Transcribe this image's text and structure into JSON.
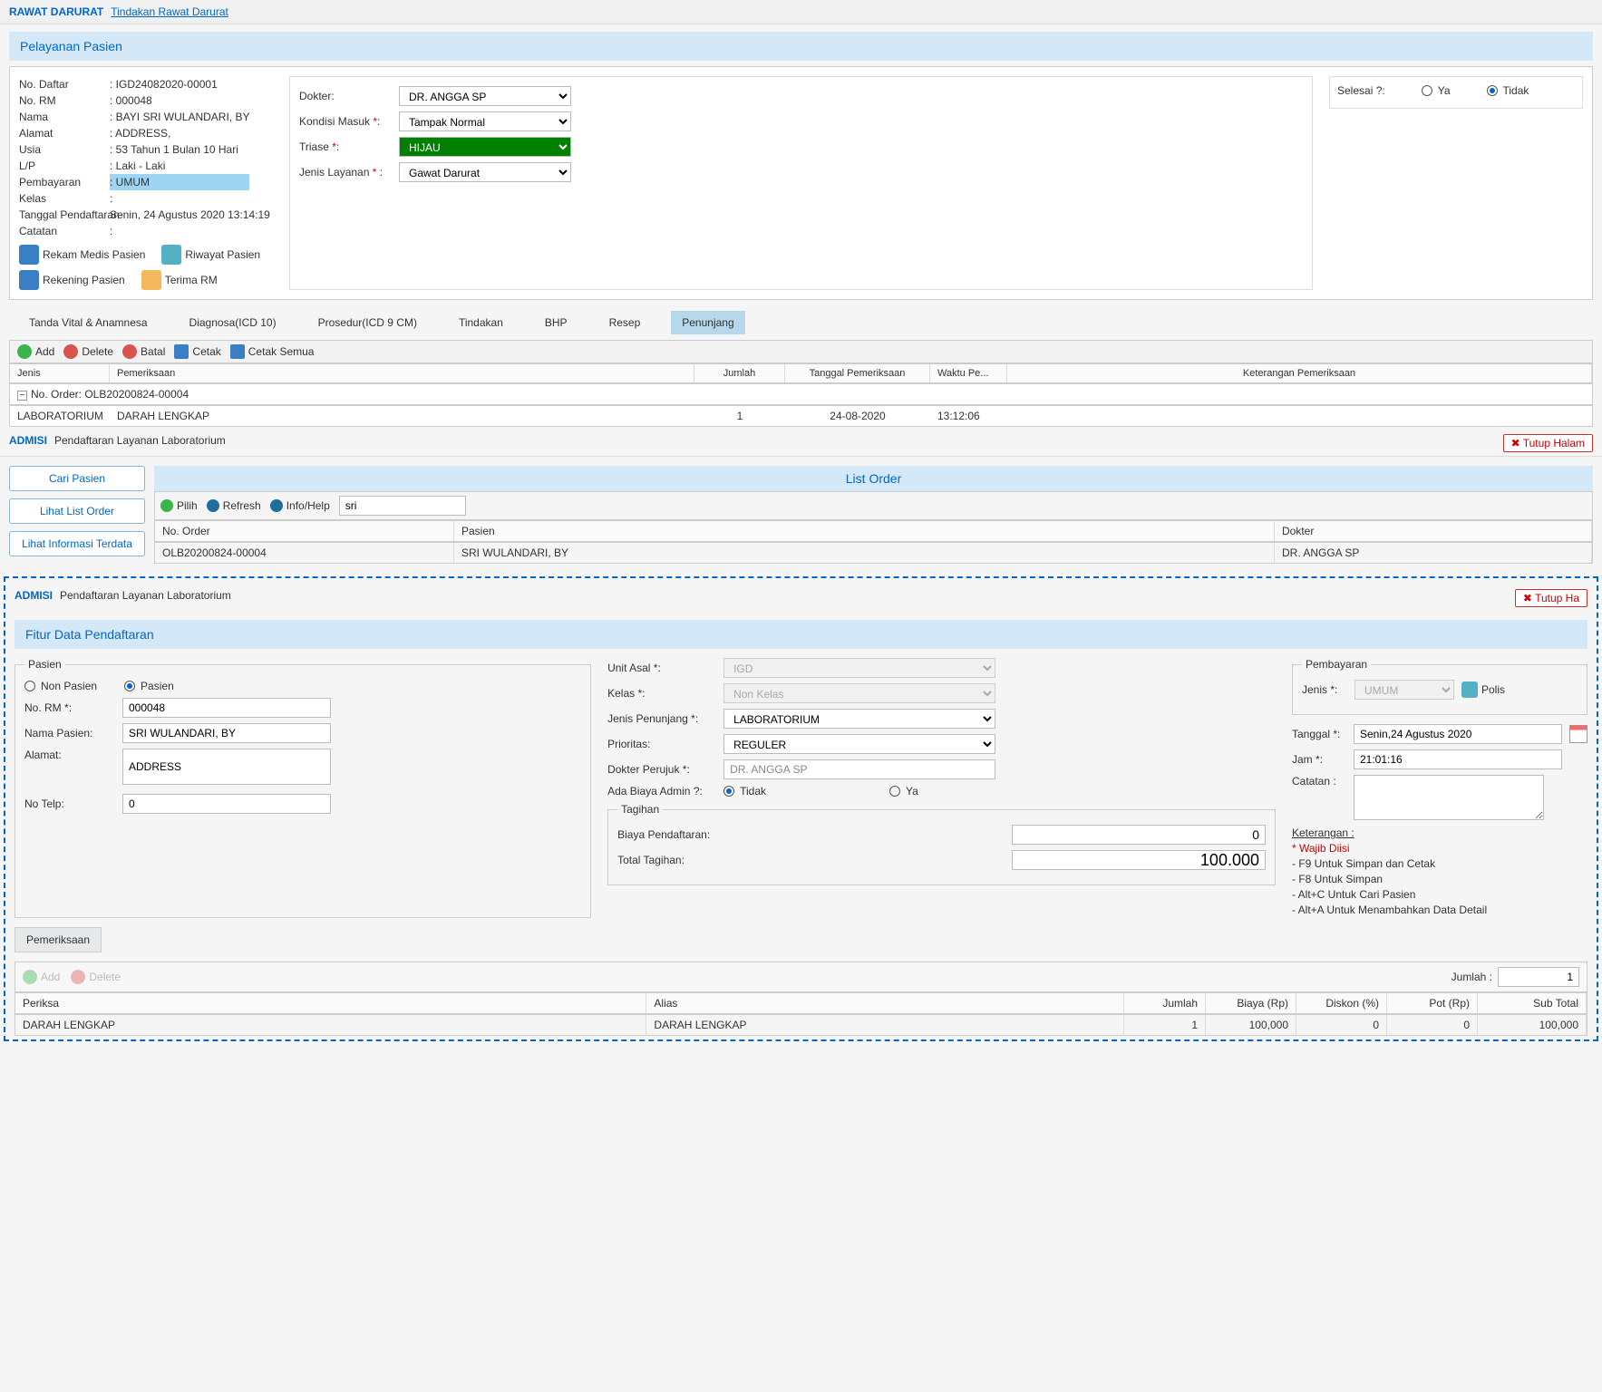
{
  "breadcrumb": {
    "section": "RAWAT DARURAT",
    "link": "Tindakan Rawat Darurat"
  },
  "pelayanan": {
    "title": "Pelayanan Pasien",
    "info": {
      "no_daftar_lbl": "No. Daftar",
      "no_daftar": "IGD24082020-00001",
      "no_rm_lbl": "No. RM",
      "no_rm": "000048",
      "nama_lbl": "Nama",
      "nama": "BAYI SRI WULANDARI, BY",
      "alamat_lbl": "Alamat",
      "alamat": "ADDRESS,",
      "usia_lbl": "Usia",
      "usia": "53 Tahun 1 Bulan 10 Hari",
      "lp_lbl": "L/P",
      "lp": "Laki - Laki",
      "pembayaran_lbl": "Pembayaran",
      "pembayaran": "UMUM",
      "kelas_lbl": "Kelas",
      "kelas": "",
      "tgl_lbl": "Tanggal Pendaftaran",
      "tgl": "Senin, 24 Agustus 2020 13:14:19",
      "catatan_lbl": "Catatan",
      "catatan": ""
    },
    "links": {
      "rekam_medis": "Rekam Medis Pasien",
      "riwayat": "Riwayat Pasien",
      "rekening": "Rekening Pasien",
      "terima_rm": "Terima RM"
    },
    "form": {
      "dokter_lbl": "Dokter:",
      "dokter": "DR. ANGGA SP",
      "kondisi_lbl": "Kondisi Masuk ",
      "kondisi": "Tampak Normal",
      "triase_lbl": "Triase ",
      "triase": "HIJAU",
      "jenis_lbl": "Jenis Layanan ",
      "jenis": "Gawat Darurat"
    },
    "selesai": {
      "lbl": "Selesai ?:",
      "ya": "Ya",
      "tidak": "Tidak"
    }
  },
  "tabs": {
    "t1": "Tanda Vital & Anamnesa",
    "t2": "Diagnosa(ICD 10)",
    "t3": "Prosedur(ICD 9 CM)",
    "t4": "Tindakan",
    "t5": "BHP",
    "t6": "Resep",
    "t7": "Penunjang"
  },
  "toolbar": {
    "add": "Add",
    "delete": "Delete",
    "batal": "Batal",
    "cetak": "Cetak",
    "cetak_semua": "Cetak Semua"
  },
  "grid": {
    "h_jenis": "Jenis",
    "h_pem": "Pemeriksaan",
    "h_jumlah": "Jumlah",
    "h_tgl": "Tanggal Pemeriksaan",
    "h_waktu": "Waktu Pe...",
    "h_ket": "Keterangan Pemeriksaan",
    "group": "No. Order: OLB20200824-00004",
    "jenis": "LABORATORIUM",
    "pem": "DARAH LENGKAP",
    "jumlah": "1",
    "tgl": "24-08-2020",
    "waktu": "13:12:06"
  },
  "admisi": {
    "section": "ADMISI",
    "link": "Pendaftaran Layanan Laboratorium",
    "close": "Tutup Halam",
    "close2": "Tutup Ha"
  },
  "sidebar": {
    "b1": "Cari Pasien",
    "b2": "Lihat List Order",
    "b3": "Lihat Informasi Terdata"
  },
  "listorder": {
    "title": "List Order",
    "tool": {
      "pilih": "Pilih",
      "refresh": "Refresh",
      "info": "Info/Help"
    },
    "search": "sri",
    "h_order": "No. Order",
    "h_pasien": "Pasien",
    "h_dokter": "Dokter",
    "r_order": "OLB20200824-00004",
    "r_pasien": "SRI WULANDARI, BY",
    "r_dokter": "DR. ANGGA SP"
  },
  "fitur": {
    "title": "Fitur Data Pendaftaran",
    "pasien_legend": "Pasien",
    "non_pasien": "Non Pasien",
    "pasien_rad": "Pasien",
    "norm_lbl": "No. RM ",
    "norm": "000048",
    "nama_lbl": "Nama Pasien:",
    "nama": "SRI WULANDARI, BY",
    "alamat_lbl": "Alamat:",
    "alamat": "ADDRESS",
    "notelp_lbl": "No Telp:",
    "notelp": "0",
    "unit_lbl": "Unit Asal ",
    "unit": "IGD",
    "kelas_lbl": "Kelas ",
    "kelas": "Non Kelas",
    "jenispen_lbl": "Jenis Penunjang ",
    "jenispen": "LABORATORIUM",
    "prioritas_lbl": "Prioritas:",
    "prioritas": "REGULER",
    "dokter_lbl": "Dokter Perujuk ",
    "dokter": "DR. ANGGA SP",
    "biaya_lbl": "Ada Biaya Admin ?:",
    "tidak": "Tidak",
    "ya": "Ya",
    "tagihan_legend": "Tagihan",
    "biaya_p_lbl": "Biaya Pendaftaran:",
    "biaya_p": "0",
    "total_lbl": "Total Tagihan:",
    "total": "100.000",
    "pembayaran_legend": "Pembayaran",
    "jenis_lbl": "Jenis ",
    "jenis": "UMUM",
    "polis": "Polis",
    "tanggal_lbl": "Tanggal ",
    "tanggal": "Senin,24 Agustus 2020",
    "jam_lbl": "Jam ",
    "jam": "21:01:16",
    "catatan_lbl": "Catatan :",
    "ket_title": "Keterangan :",
    "ket1": "* Wajib Diisi",
    "ket2": "- F9 Untuk Simpan dan Cetak",
    "ket3": "- F8 Untuk Simpan",
    "ket4": "- Alt+C Untuk Cari Pasien",
    "ket5": "- Alt+A Untuk Menambahkan Data Detail"
  },
  "pemeriksaan": {
    "tab": "Pemeriksaan",
    "add": "Add",
    "del": "Delete",
    "jumlah_lbl": "Jumlah :",
    "jumlah": "1",
    "h1": "Periksa",
    "h2": "Alias",
    "h3": "Jumlah",
    "h4": "Biaya (Rp)",
    "h5": "Diskon (%)",
    "h6": "Pot (Rp)",
    "h7": "Sub Total",
    "c1": "DARAH LENGKAP",
    "c2": "DARAH LENGKAP",
    "c3": "1",
    "c4": "100,000",
    "c5": "0",
    "c6": "0",
    "c7": "100,000"
  }
}
